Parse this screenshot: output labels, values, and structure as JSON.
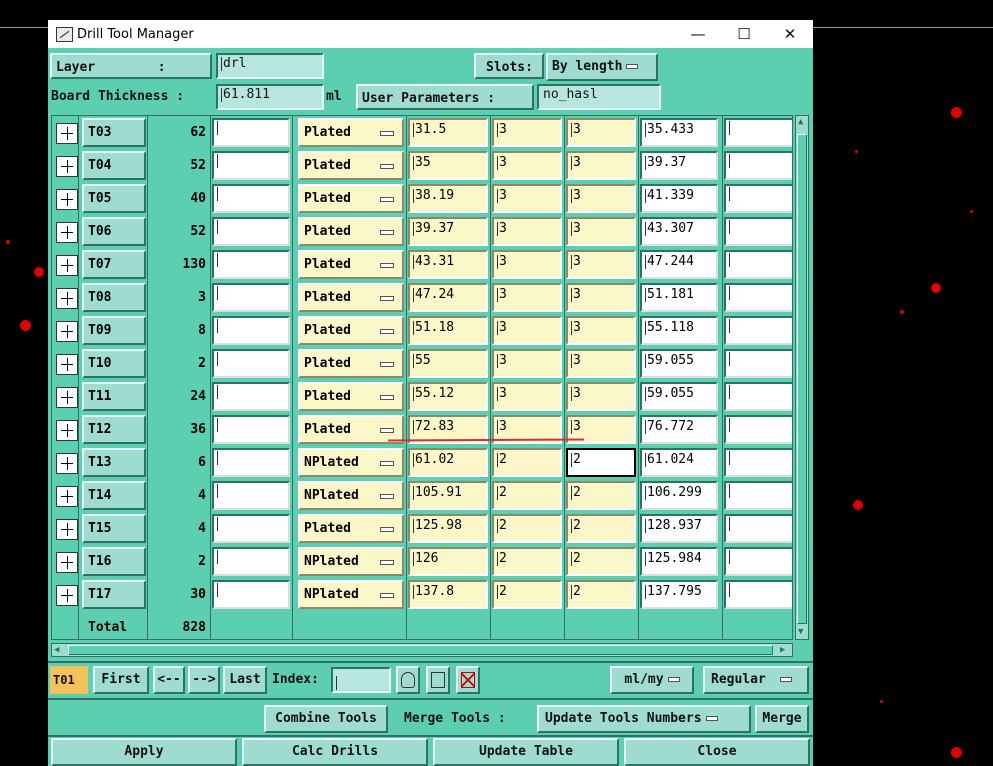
{
  "window": {
    "title": "Drill Tool Manager",
    "minimize": "—",
    "maximize": "☐",
    "close": "✕"
  },
  "header": {
    "layer_label": "Layer        :",
    "layer_value": "drl",
    "slots_label": "Slots:",
    "slots_value": "By length",
    "board_thickness_label": "Board Thickness :",
    "board_thickness_value": "61.811",
    "board_thickness_unit": "ml",
    "user_params_label": "User Parameters :",
    "user_params_value": "no_hasl"
  },
  "tools": [
    {
      "tool": "T03",
      "count": "62",
      "type": "Plated",
      "a": "31.5",
      "b": "3",
      "c": "3",
      "finish": "35.433"
    },
    {
      "tool": "T04",
      "count": "52",
      "type": "Plated",
      "a": "35",
      "b": "3",
      "c": "3",
      "finish": "39.37"
    },
    {
      "tool": "T05",
      "count": "40",
      "type": "Plated",
      "a": "38.19",
      "b": "3",
      "c": "3",
      "finish": "41.339"
    },
    {
      "tool": "T06",
      "count": "52",
      "type": "Plated",
      "a": "39.37",
      "b": "3",
      "c": "3",
      "finish": "43.307"
    },
    {
      "tool": "T07",
      "count": "130",
      "type": "Plated",
      "a": "43.31",
      "b": "3",
      "c": "3",
      "finish": "47.244"
    },
    {
      "tool": "T08",
      "count": "3",
      "type": "Plated",
      "a": "47.24",
      "b": "3",
      "c": "3",
      "finish": "51.181"
    },
    {
      "tool": "T09",
      "count": "8",
      "type": "Plated",
      "a": "51.18",
      "b": "3",
      "c": "3",
      "finish": "55.118"
    },
    {
      "tool": "T10",
      "count": "2",
      "type": "Plated",
      "a": "55",
      "b": "3",
      "c": "3",
      "finish": "59.055"
    },
    {
      "tool": "T11",
      "count": "24",
      "type": "Plated",
      "a": "55.12",
      "b": "3",
      "c": "3",
      "finish": "59.055"
    },
    {
      "tool": "T12",
      "count": "36",
      "type": "Plated",
      "a": "72.83",
      "b": "3",
      "c": "3",
      "finish": "76.772"
    },
    {
      "tool": "T13",
      "count": "6",
      "type": "NPlated",
      "a": "61.02",
      "b": "2",
      "c": "2",
      "finish": "61.024"
    },
    {
      "tool": "T14",
      "count": "4",
      "type": "NPlated",
      "a": "105.91",
      "b": "2",
      "c": "2",
      "finish": "106.299"
    },
    {
      "tool": "T15",
      "count": "4",
      "type": "Plated",
      "a": "125.98",
      "b": "2",
      "c": "2",
      "finish": "128.937"
    },
    {
      "tool": "T16",
      "count": "2",
      "type": "NPlated",
      "a": "126",
      "b": "2",
      "c": "2",
      "finish": "125.984"
    },
    {
      "tool": "T17",
      "count": "30",
      "type": "NPlated",
      "a": "137.8",
      "b": "2",
      "c": "2",
      "finish": "137.795"
    }
  ],
  "total": {
    "label": "Total",
    "value": "828"
  },
  "nav": {
    "current_tool": "T01",
    "first": "First",
    "prev": "<--",
    "next": "-->",
    "last": "Last",
    "index_label": "Index:",
    "units": "ml/my",
    "mode": "Regular"
  },
  "actions": {
    "combine": "Combine Tools",
    "merge_label": "Merge Tools :",
    "merge_mode": "Update Tools Numbers",
    "merge": "Merge",
    "apply": "Apply",
    "calc": "Calc Drills",
    "update": "Update Table",
    "close": "Close"
  }
}
